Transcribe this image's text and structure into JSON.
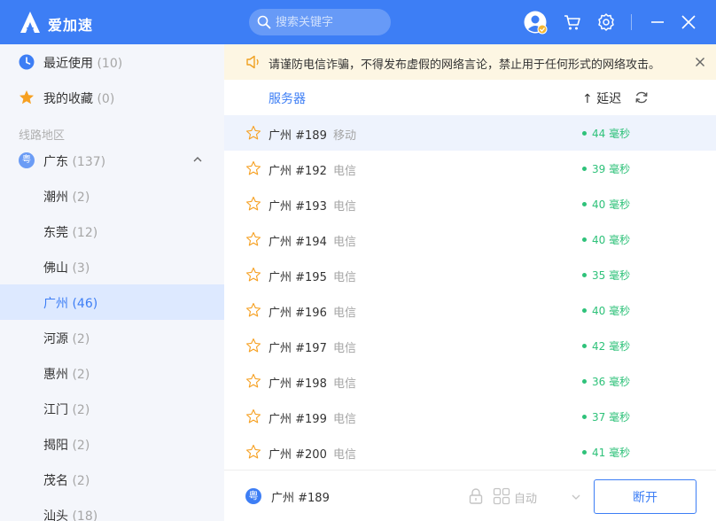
{
  "app": {
    "title": "爱加速"
  },
  "search": {
    "placeholder": "搜索关键字"
  },
  "sidebar": {
    "top_items": [
      {
        "label": "最近使用",
        "count": "(10)",
        "icon": "clock-icon"
      },
      {
        "label": "我的收藏",
        "count": "(0)",
        "icon": "star-icon"
      }
    ],
    "section_label": "线路地区",
    "province": {
      "label": "广东",
      "count": "(137)",
      "badge": "粤"
    },
    "cities": [
      {
        "label": "潮州",
        "count": "(2)"
      },
      {
        "label": "东莞",
        "count": "(12)"
      },
      {
        "label": "佛山",
        "count": "(3)"
      },
      {
        "label": "广州",
        "count": "(46)"
      },
      {
        "label": "河源",
        "count": "(2)"
      },
      {
        "label": "惠州",
        "count": "(2)"
      },
      {
        "label": "江门",
        "count": "(2)"
      },
      {
        "label": "揭阳",
        "count": "(2)"
      },
      {
        "label": "茂名",
        "count": "(2)"
      },
      {
        "label": "汕头",
        "count": "(18)"
      }
    ]
  },
  "notice": {
    "text": "请谨防电信诈骗，不得发布虚假的网络言论，禁止用于任何形式的网络攻击。"
  },
  "list_header": {
    "server": "服务器",
    "latency": "↑ 延迟"
  },
  "servers": [
    {
      "name": "广州 #189",
      "isp": "移动",
      "ping": "44 毫秒"
    },
    {
      "name": "广州 #192",
      "isp": "电信",
      "ping": "39 毫秒"
    },
    {
      "name": "广州 #193",
      "isp": "电信",
      "ping": "40 毫秒"
    },
    {
      "name": "广州 #194",
      "isp": "电信",
      "ping": "40 毫秒"
    },
    {
      "name": "广州 #195",
      "isp": "电信",
      "ping": "35 毫秒"
    },
    {
      "name": "广州 #196",
      "isp": "电信",
      "ping": "40 毫秒"
    },
    {
      "name": "广州 #197",
      "isp": "电信",
      "ping": "42 毫秒"
    },
    {
      "name": "广州 #198",
      "isp": "电信",
      "ping": "36 毫秒"
    },
    {
      "name": "广州 #199",
      "isp": "电信",
      "ping": "37 毫秒"
    },
    {
      "name": "广州 #200",
      "isp": "电信",
      "ping": "41 毫秒"
    }
  ],
  "bottom": {
    "badge": "粤",
    "current_server": "广州 #189",
    "mode": "自动",
    "disconnect_label": "断开"
  },
  "colors": {
    "accent": "#3d7ef5",
    "ping_green": "#2fc27a",
    "notice_bg": "#fdf6e3"
  }
}
